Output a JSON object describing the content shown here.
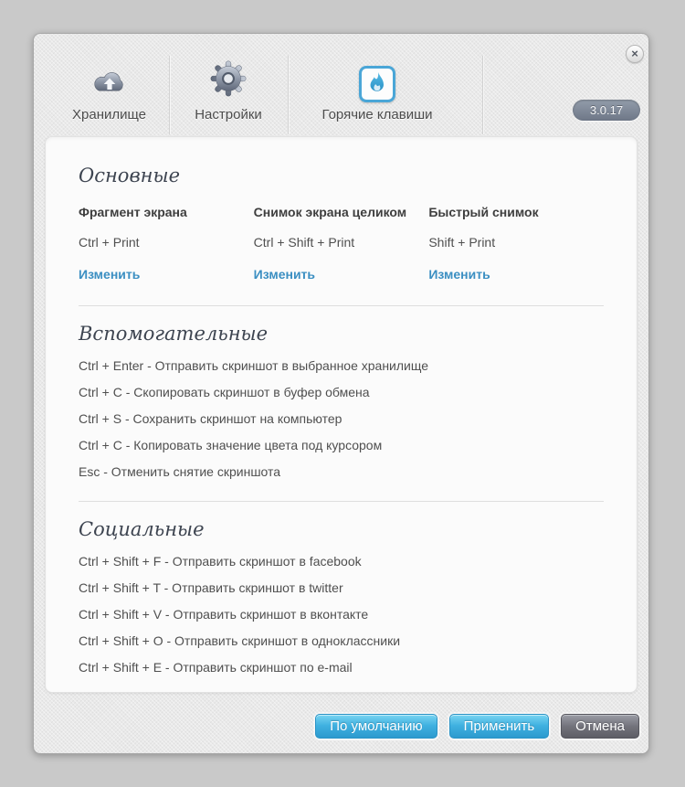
{
  "app": {
    "version": "3.0.17",
    "close_glyph": "×"
  },
  "tabs": [
    {
      "label": "Хранилище",
      "icon": "cloud-upload",
      "active": false
    },
    {
      "label": "Настройки",
      "icon": "gear",
      "active": false
    },
    {
      "label": "Горячие клавиши",
      "icon": "flame",
      "active": true
    }
  ],
  "sections": {
    "main": {
      "title": "Основные",
      "hotkeys": [
        {
          "name": "Фрагмент экрана",
          "combo": "Ctrl + Print",
          "change": "Изменить"
        },
        {
          "name": "Снимок экрана целиком",
          "combo": "Ctrl + Shift + Print",
          "change": "Изменить"
        },
        {
          "name": "Быстрый снимок",
          "combo": "Shift + Print",
          "change": "Изменить"
        }
      ]
    },
    "auxiliary": {
      "title": "Вспомогательные",
      "items": [
        "Ctrl + Enter - Отправить скриншот в выбранное хранилище",
        "Ctrl + C - Скопировать скриншот в буфер обмена",
        "Ctrl + S - Сохранить скриншот на компьютер",
        "Ctrl + C - Копировать значение цвета под курсором",
        "Esc - Отменить снятие скриншота"
      ]
    },
    "social": {
      "title": "Социальные",
      "items": [
        "Ctrl + Shift + F - Отправить скриншот в facebook",
        "Ctrl + Shift + T - Отправить скриншот в twitter",
        "Ctrl + Shift + V - Отправить скриншот в вконтакте",
        "Ctrl + Shift + O - Отправить скриншот в одноклассники",
        "Ctrl + Shift + E - Отправить скриншот по e-mail"
      ]
    }
  },
  "footer": {
    "default_label": "По умолчанию",
    "apply_label": "Применить",
    "cancel_label": "Отмена"
  },
  "colors": {
    "accent_blue": "#3fb0e0",
    "link_blue": "#3b8fc2",
    "cancel_gray": "#6c6c74",
    "badge_gray": "#7b8594"
  }
}
